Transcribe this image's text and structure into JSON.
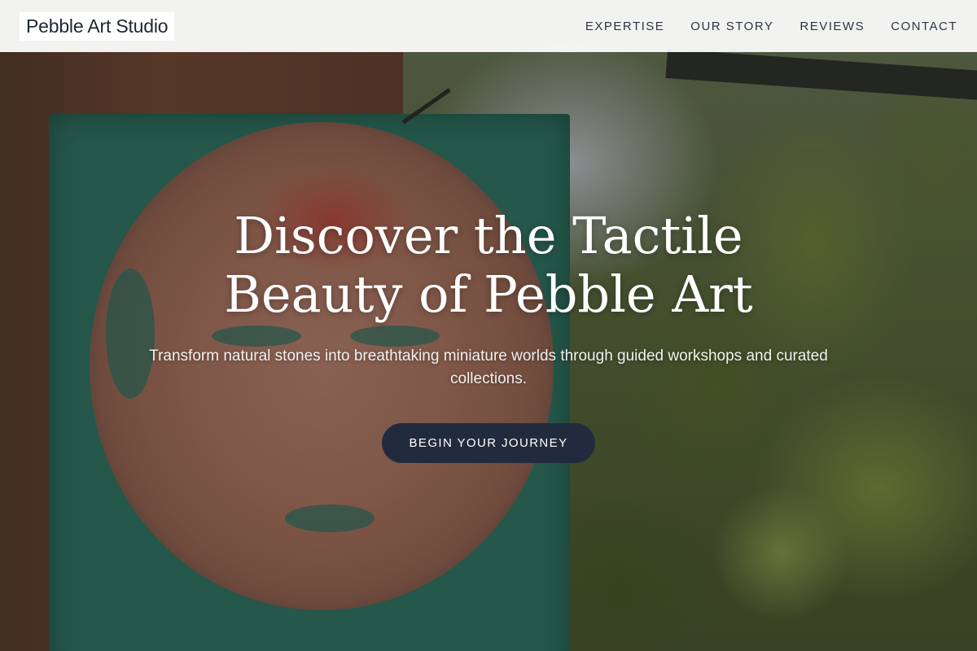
{
  "header": {
    "logo": "Pebble Art Studio",
    "nav": [
      {
        "label": "EXPERTISE"
      },
      {
        "label": "OUR STORY"
      },
      {
        "label": "REVIEWS"
      },
      {
        "label": "CONTACT"
      }
    ]
  },
  "hero": {
    "title_line1": "Discover the Tactile",
    "title_line2": "Beauty of Pebble Art",
    "subtitle": "Transform natural stones into breathtaking miniature worlds through guided workshops and curated collections.",
    "cta_label": "BEGIN YOUR JOURNEY"
  },
  "colors": {
    "header_bg": "#ffffff",
    "logo_text": "#1f2733",
    "nav_text": "#2d3442",
    "cta_bg": "#222b3e",
    "cta_text": "#ffffff",
    "hero_text": "#ffffff"
  }
}
